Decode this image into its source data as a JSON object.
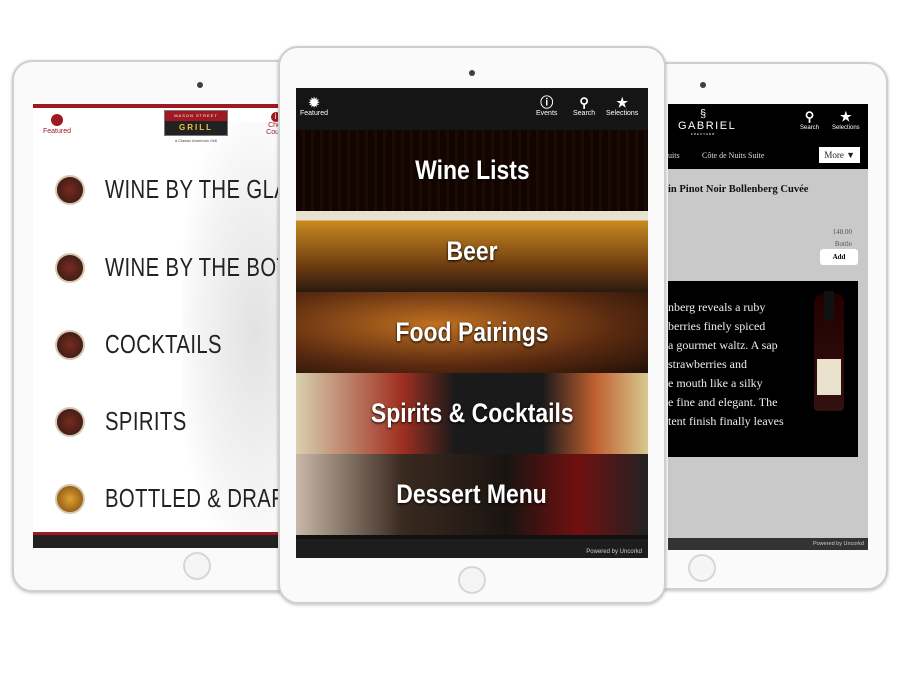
{
  "left_app": {
    "featured": "Featured",
    "logo": {
      "top": "MASON STREET",
      "main": "GRILL",
      "tagline": "a Classic American Grill"
    },
    "chef_label": "Chef Count",
    "menu": [
      {
        "label": "WINE BY THE GLAS",
        "icon": "wine-glass-icon"
      },
      {
        "label": "WINE BY THE BOTT",
        "icon": "wine-bottle-icon"
      },
      {
        "label": "COCKTAILS",
        "icon": "cocktail-icon"
      },
      {
        "label": "SPIRITS",
        "icon": "spirits-icon"
      },
      {
        "label": "BOTTLED & DRAFT",
        "icon": "beer-icon"
      }
    ],
    "accent": "#a01820"
  },
  "mid_app": {
    "header": {
      "featured": "Featured",
      "events": "Events",
      "search": "Search",
      "selections": "Selections"
    },
    "tiles": [
      "Wine Lists",
      "Beer",
      "Food Pairings",
      "Spirits & Cocktails",
      "Dessert Menu"
    ],
    "footer": "Powered by Uncorkd"
  },
  "right_app": {
    "brand": "GABRIEL",
    "brand_sub": "KREUTHER",
    "search": "Search",
    "selections": "Selections",
    "tabs": [
      "uits",
      "Côte de Nuits Suite"
    ],
    "more": "More ▼",
    "wine_title": "in Pinot Noir Bollenberg Cuvée",
    "price": "148.00",
    "unit": "Bottle",
    "add": "Add",
    "description": [
      "nberg reveals a ruby",
      "berries finely spiced",
      "a gourmet waltz. A sap",
      "strawberries and",
      "e mouth like a silky",
      "e fine and elegant. The",
      "tent finish finally leaves"
    ],
    "footer": "Powered by Uncorkd"
  }
}
